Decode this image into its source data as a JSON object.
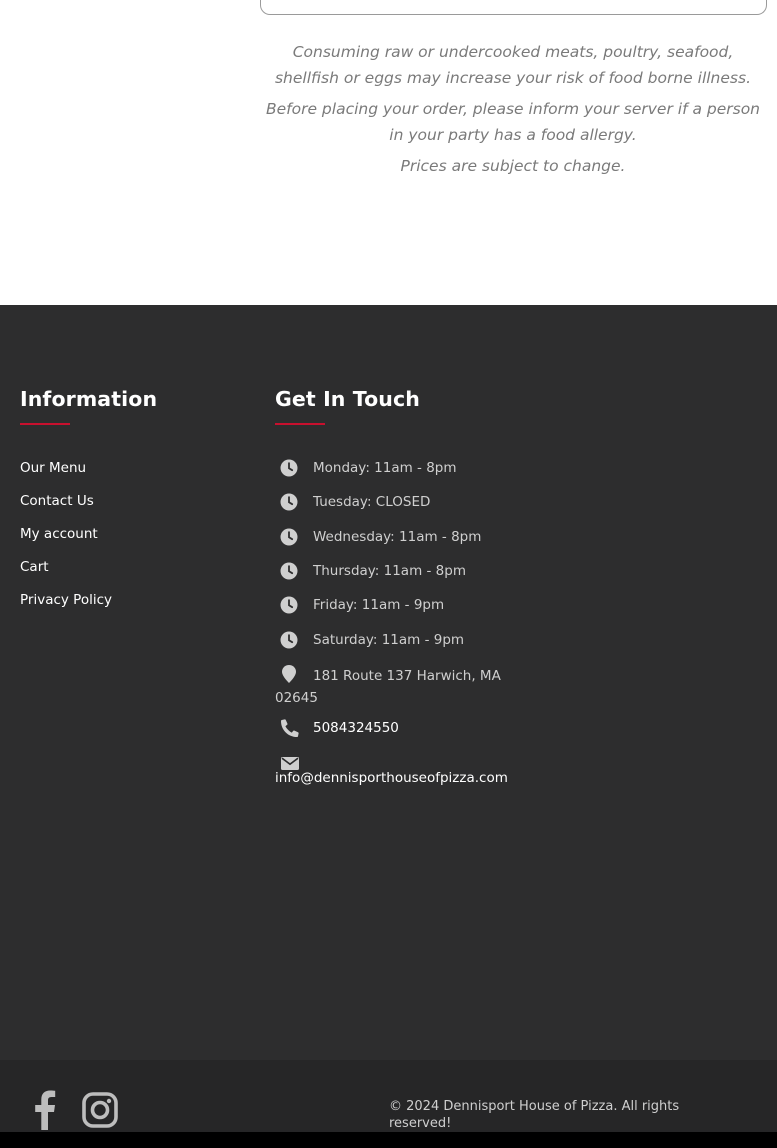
{
  "disclaimers": {
    "line1": "Consuming raw or undercooked meats, poultry, seafood, shellfish or eggs may increase your risk of food borne illness.",
    "line2": "Before placing your order, please inform your server if a person in your party has a food allergy.",
    "line3": "Prices are subject to change."
  },
  "footer": {
    "information": {
      "title": "Information",
      "links": [
        {
          "label": "Our Menu"
        },
        {
          "label": "Contact Us"
        },
        {
          "label": "My account"
        },
        {
          "label": "Cart"
        },
        {
          "label": "Privacy Policy"
        }
      ]
    },
    "contact": {
      "title": "Get In Touch",
      "hours": [
        {
          "label": "Monday: 11am - 8pm",
          "icon": "clock-icon"
        },
        {
          "label": "Tuesday: CLOSED",
          "icon": "clock-icon"
        },
        {
          "label": "Wednesday: 11am - 8pm",
          "icon": "clock-icon"
        },
        {
          "label": "Thursday: 11am - 8pm",
          "icon": "clock-icon"
        },
        {
          "label": "Friday: 11am - 9pm",
          "icon": "clock-icon"
        },
        {
          "label": "Saturday: 11am - 9pm",
          "icon": "clock-icon"
        }
      ],
      "address": "181 Route 137 Harwich, MA 02645",
      "phone": "5084324550",
      "email": "info@dennisporthouseofpizza.com"
    },
    "bottom": {
      "social": [
        {
          "name": "facebook",
          "icon": "facebook-icon"
        },
        {
          "name": "instagram",
          "icon": "instagram-icon"
        }
      ],
      "copyright": "© 2024 Dennisport House of Pizza. All rights reserved!"
    },
    "colors": {
      "background": "#2d2d2e",
      "bottom_bar": "#262627",
      "accent": "#c8102e",
      "link": "#ffffff",
      "muted_text": "#cfcfcf"
    }
  }
}
